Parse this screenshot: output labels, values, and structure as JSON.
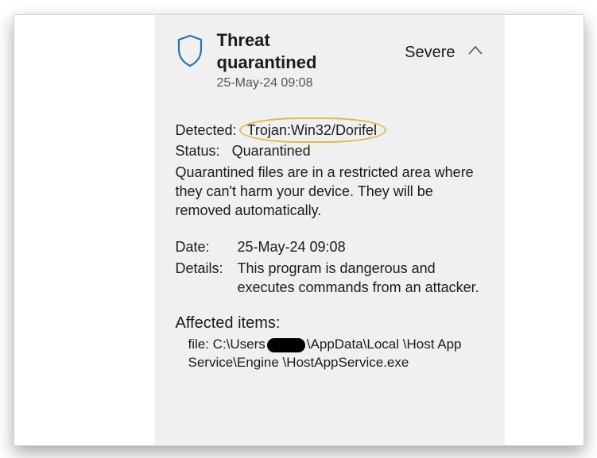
{
  "header": {
    "title_line1": "Threat",
    "title_line2": "quarantined",
    "timestamp": "25-May-24 09:08",
    "severity": "Severe"
  },
  "detected": {
    "label": "Detected:",
    "value": "Trojan:Win32/Dorifel"
  },
  "status": {
    "label": "Status:",
    "value": "Quarantined"
  },
  "description": "Quarantined files are in a restricted area where they can't harm your device. They will be removed automatically.",
  "date": {
    "label": "Date:",
    "value": "25-May-24 09:08"
  },
  "details": {
    "label": "Details:",
    "value": "This program is dangerous and executes commands from an attacker."
  },
  "affected": {
    "heading": "Affected items:",
    "file_prefix": "file: C:\\Users",
    "file_suffix": "\\AppData\\Local \\Host App Service\\Engine \\HostAppService.exe"
  },
  "colors": {
    "shield_stroke": "#2a6fb5",
    "highlight": "#e5b84a"
  }
}
